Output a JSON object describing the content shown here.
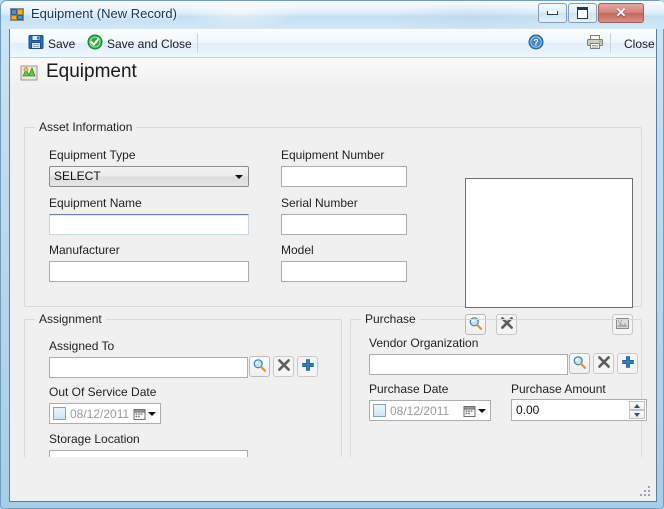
{
  "window": {
    "title": "Equipment (New Record)",
    "app_icon": "form-icon",
    "buttons": {
      "minimize": "Minimize",
      "maximize": "Maximize",
      "close": "✕"
    }
  },
  "toolbar": {
    "save_label": "Save",
    "save_and_close_label": "Save and Close",
    "help_label": "Help",
    "print_label": "Print",
    "close_label": "Close"
  },
  "page": {
    "title": "Equipment",
    "icon": "equipment-icon"
  },
  "asset_information": {
    "legend": "Asset Information",
    "equipment_type": {
      "label": "Equipment Type",
      "value": "SELECT"
    },
    "equipment_name": {
      "label": "Equipment Name",
      "value": ""
    },
    "manufacturer": {
      "label": "Manufacturer",
      "value": ""
    },
    "equipment_number": {
      "label": "Equipment Number",
      "value": ""
    },
    "serial_number": {
      "label": "Serial Number",
      "value": ""
    },
    "model": {
      "label": "Model",
      "value": ""
    },
    "picture": {
      "browse_label": "Browse",
      "clear_label": "Clear",
      "image_label": "Image"
    }
  },
  "assignment": {
    "legend": "Assignment",
    "assigned_to": {
      "label": "Assigned To",
      "value": "",
      "search_label": "Search",
      "clear_label": "Clear",
      "add_label": "Add"
    },
    "out_of_service_date": {
      "label": "Out Of Service Date",
      "value": "08/12/2011",
      "checked": false
    },
    "storage_location": {
      "label": "Storage Location",
      "value": ""
    }
  },
  "purchase": {
    "legend": "Purchase",
    "vendor_organization": {
      "label": "Vendor Organization",
      "value": "",
      "search_label": "Search",
      "clear_label": "Clear",
      "add_label": "Add"
    },
    "purchase_date": {
      "label": "Purchase Date",
      "value": "08/12/2011",
      "checked": false
    },
    "purchase_amount": {
      "label": "Purchase Amount",
      "value": "0.00"
    }
  },
  "colors": {
    "accent_blue": "#2e6da4",
    "save_green": "#1c9c36",
    "frame_blue": "#6f9dc0",
    "client_bg": "#f0f0f0",
    "close_red": "#c16a60"
  }
}
